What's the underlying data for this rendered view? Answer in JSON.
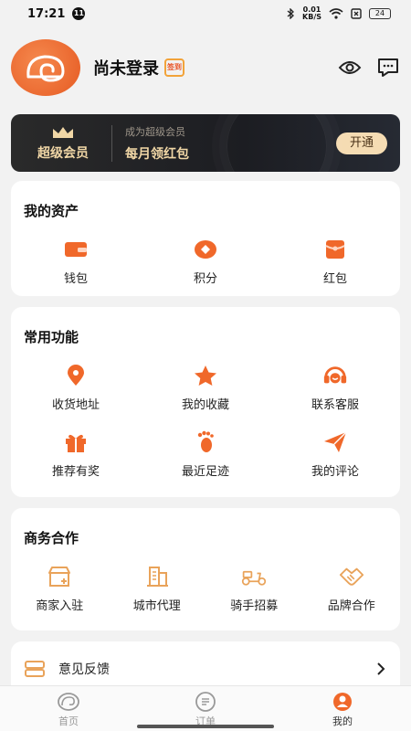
{
  "status_bar": {
    "time": "17:21",
    "notification_count": "11",
    "net_speed_value": "0.01",
    "net_speed_unit": "KB/S",
    "battery": "24"
  },
  "profile": {
    "name": "尚未登录",
    "sign_badge": "签到"
  },
  "vip": {
    "title": "超级会员",
    "subtitle": "成为超级会员",
    "promo": "每月领红包",
    "open_label": "开通"
  },
  "assets": {
    "title": "我的资产",
    "items": [
      {
        "label": "钱包",
        "icon": "wallet-icon"
      },
      {
        "label": "积分",
        "icon": "points-icon"
      },
      {
        "label": "红包",
        "icon": "red-packet-icon"
      }
    ]
  },
  "functions": {
    "title": "常用功能",
    "items": [
      {
        "label": "收货地址",
        "icon": "location-icon"
      },
      {
        "label": "我的收藏",
        "icon": "star-icon"
      },
      {
        "label": "联系客服",
        "icon": "headset-icon"
      },
      {
        "label": "推荐有奖",
        "icon": "gift-icon"
      },
      {
        "label": "最近足迹",
        "icon": "footprint-icon"
      },
      {
        "label": "我的评论",
        "icon": "send-icon"
      }
    ]
  },
  "business": {
    "title": "商务合作",
    "items": [
      {
        "label": "商家入驻",
        "icon": "store-icon"
      },
      {
        "label": "城市代理",
        "icon": "building-icon"
      },
      {
        "label": "骑手招募",
        "icon": "scooter-icon"
      },
      {
        "label": "品牌合作",
        "icon": "handshake-icon"
      }
    ]
  },
  "feedback": {
    "label": "意见反馈"
  },
  "tabbar": {
    "items": [
      {
        "label": "首页"
      },
      {
        "label": "订单"
      },
      {
        "label": "我的"
      }
    ]
  },
  "colors": {
    "accent": "#f0682a",
    "vip_gold": "#f1d7a6"
  }
}
